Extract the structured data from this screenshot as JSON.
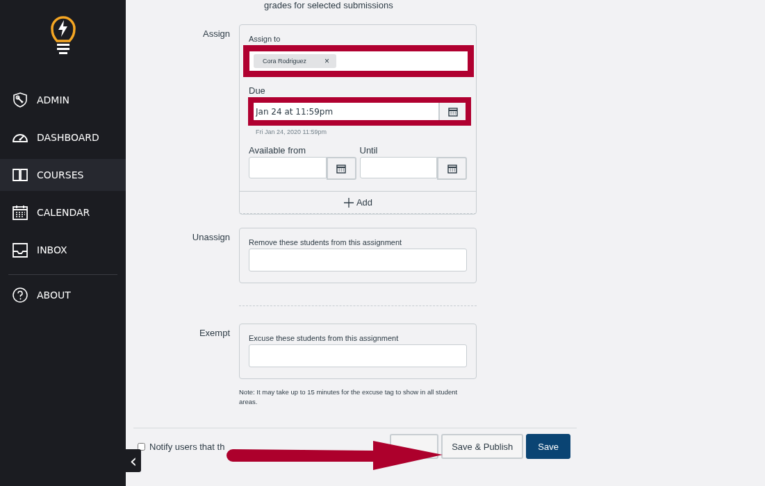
{
  "sidebar": {
    "items": [
      {
        "label": "ADMIN",
        "kind": "admin",
        "selected": false
      },
      {
        "label": "DASHBOARD",
        "kind": "dashboard",
        "selected": false
      },
      {
        "label": "COURSES",
        "kind": "courses",
        "selected": true
      },
      {
        "label": "CALENDAR",
        "kind": "calendar",
        "selected": false
      },
      {
        "label": "INBOX",
        "kind": "inbox",
        "selected": false
      }
    ],
    "footer_items": [
      {
        "label": "ABOUT",
        "kind": "about",
        "selected": false
      }
    ],
    "collapse_label": "‹"
  },
  "top_text": "grades for selected submissions",
  "assign": {
    "label": "Assign",
    "assign_to_label": "Assign to",
    "assign_to_highlighted": true,
    "assignees": [
      {
        "name": "Cora Rodriguez",
        "remove": "×"
      }
    ],
    "due_label": "Due",
    "due_value": "Jan 24 at 11:59pm",
    "due_highlighted": true,
    "due_hint": "Fri Jan 24, 2020 11:59pm",
    "available_from_label": "Available from",
    "until_label": "Until",
    "add_label": "Add"
  },
  "unassign": {
    "label": "Unassign",
    "hint": "Remove these students from this assignment"
  },
  "exempt": {
    "label": "Exempt",
    "hint": "Excuse these students from this assignment",
    "note": "Note: It may take up to 15 minutes for the excuse tag to show in all student areas."
  },
  "footer": {
    "notify_label": "Notify users that th",
    "notify_checked": false,
    "buttons": [
      {
        "label": "Save & Publish",
        "kind": "secondary"
      },
      {
        "label": "Save",
        "kind": "primary"
      }
    ]
  },
  "annotation_arrow": true
}
